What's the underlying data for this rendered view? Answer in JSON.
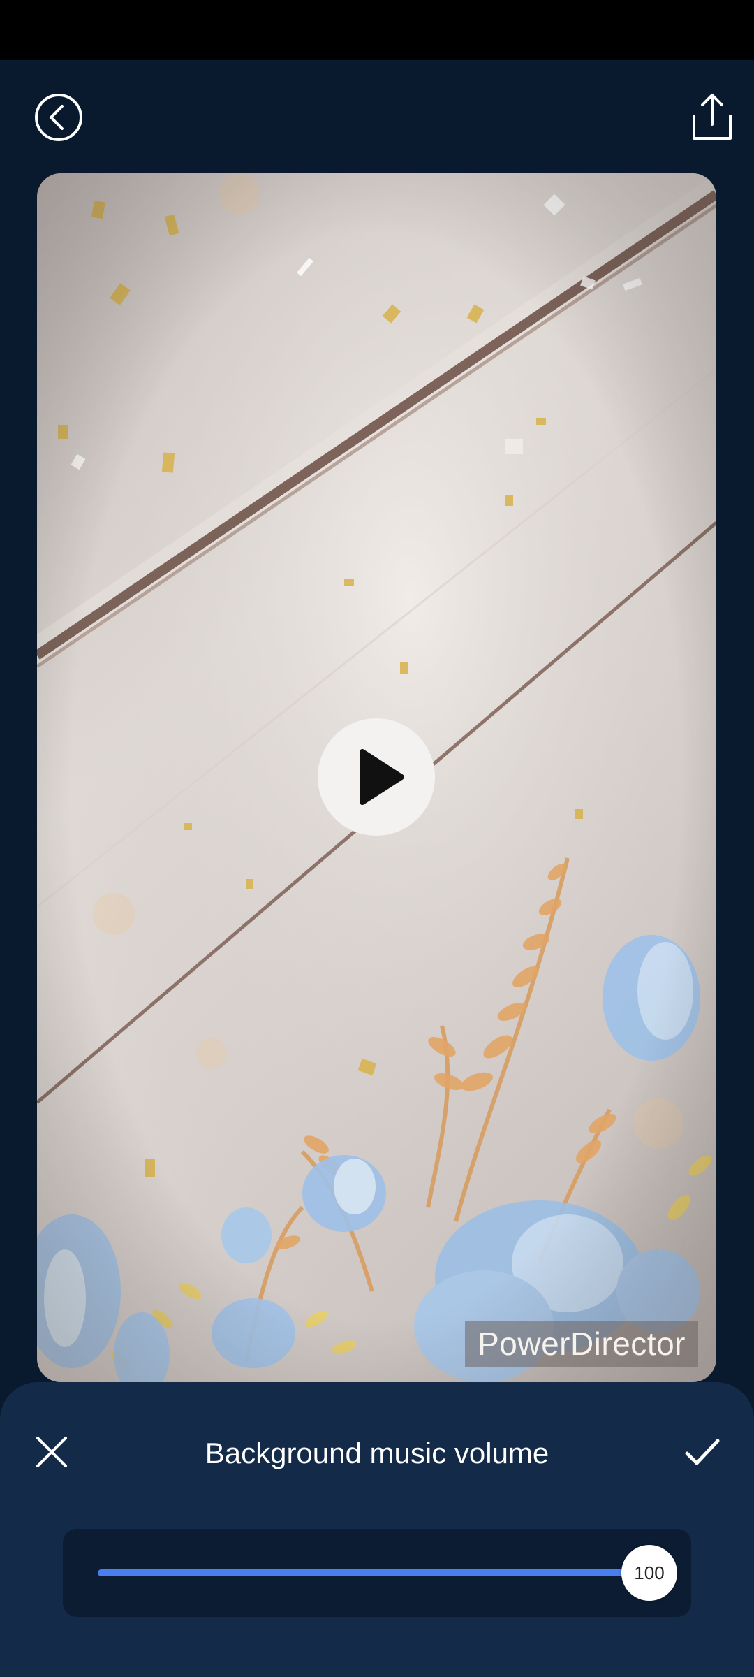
{
  "header": {
    "back_icon": "chevron-left-circle-icon",
    "share_icon": "share-upload-icon"
  },
  "preview": {
    "watermark": "PowerDirector",
    "play_icon": "play-icon"
  },
  "sheet": {
    "title": "Background music volume",
    "close_icon": "close-icon",
    "confirm_icon": "checkmark-icon"
  },
  "volume": {
    "value": "100",
    "max": 100,
    "accent_color": "#4a7fef"
  }
}
